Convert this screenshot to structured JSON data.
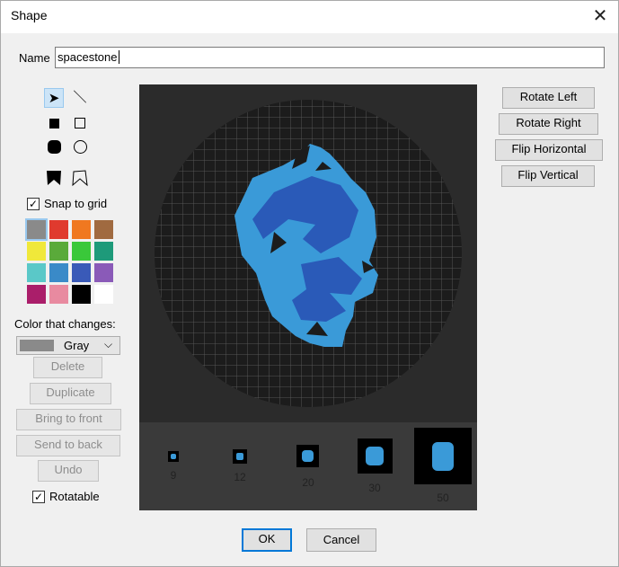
{
  "dialog": {
    "title": "Shape",
    "name_label": "Name",
    "name_value": "spacestone",
    "snap_label": "Snap to grid",
    "color_changes_label": "Color that changes:",
    "color_select_value": "Gray",
    "buttons": {
      "rotate_left": "Rotate Left",
      "rotate_right": "Rotate Right",
      "flip_h": "Flip Horizontal",
      "flip_v": "Flip Vertical",
      "delete": "Delete",
      "duplicate": "Duplicate",
      "bring_front": "Bring to front",
      "send_back": "Send to back",
      "undo": "Undo",
      "ok": "OK",
      "cancel": "Cancel"
    },
    "rotatable_label": "Rotatable",
    "thumb_sizes": [
      "9",
      "12",
      "20",
      "30",
      "50"
    ],
    "palette": [
      "#8a8a8a",
      "#e03a2e",
      "#f07820",
      "#a06a40",
      "#f0e83a",
      "#5aaa3a",
      "#3ac83a",
      "#1e9a7a",
      "#5ac8c8",
      "#3a8ac8",
      "#3a5ab8",
      "#8a5ab8",
      "#aa1e6a",
      "#e88aa0",
      "#000000",
      "#ffffff"
    ],
    "colors": {
      "light_blue": "#3a9ad8",
      "dark_blue": "#2a5ab8",
      "background": "#2b2b2b",
      "circle": "#1c1c1c"
    }
  }
}
